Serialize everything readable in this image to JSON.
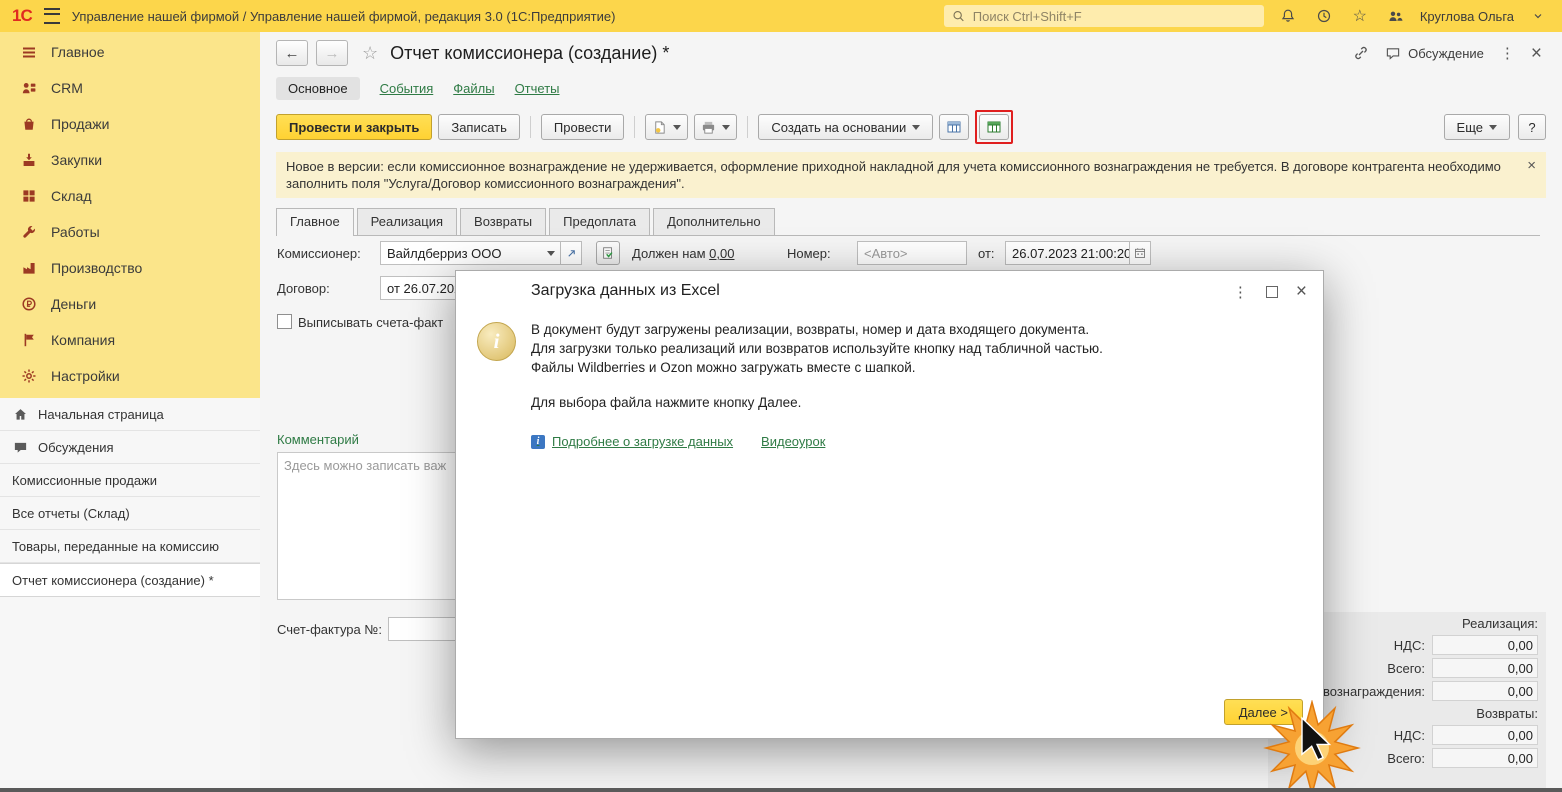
{
  "topbar": {
    "logo": "1С",
    "title": "Управление нашей фирмой / Управление нашей фирмой, редакция 3.0  (1С:Предприятие)",
    "search_placeholder": "Поиск Ctrl+Shift+F",
    "user_name": "Круглова Ольга"
  },
  "sidebar": {
    "sections": [
      {
        "icon": "main-menu-icon",
        "label": "Главное"
      },
      {
        "icon": "crm-icon",
        "label": "CRM"
      },
      {
        "icon": "sales-icon",
        "label": "Продажи"
      },
      {
        "icon": "purchases-icon",
        "label": "Закупки"
      },
      {
        "icon": "warehouse-icon",
        "label": "Склад"
      },
      {
        "icon": "works-icon",
        "label": "Работы"
      },
      {
        "icon": "production-icon",
        "label": "Производство"
      },
      {
        "icon": "money-icon",
        "label": "Деньги"
      },
      {
        "icon": "company-icon",
        "label": "Компания"
      },
      {
        "icon": "settings-icon",
        "label": "Настройки"
      }
    ],
    "pages": [
      {
        "label": "Начальная страница"
      },
      {
        "label": "Обсуждения"
      },
      {
        "label": "Комиссионные продажи"
      },
      {
        "label": "Все отчеты (Склад)"
      },
      {
        "label": "Товары, переданные на комиссию"
      },
      {
        "label": "Отчет комиссионера (создание) *"
      }
    ]
  },
  "doc": {
    "title": "Отчет комиссионера (создание) *",
    "discussion_label": "Обсуждение",
    "section_tabs": [
      "Основное",
      "События",
      "Файлы",
      "Отчеты"
    ],
    "toolbar": {
      "post_and_close": "Провести и закрыть",
      "save": "Записать",
      "post": "Провести",
      "create_based_on": "Создать на основании",
      "more": "Еще",
      "help": "?"
    },
    "notice": "Новое в версии: если комиссионное вознаграждение не удерживается, оформление приходной накладной для учета комиссионного вознаграждения не требуется. В договоре контрагента необходимо заполнить поля \"Услуга/Договор комиссионного вознаграждения\".",
    "doc_tabs": [
      "Главное",
      "Реализация",
      "Возвраты",
      "Предоплата",
      "Дополнительно"
    ],
    "form": {
      "commissioner_label": "Комиссионер:",
      "commissioner_value": "Вайлдберриз ООО",
      "owes_label": "Должен нам",
      "owes_value": "0,00",
      "number_label": "Номер:",
      "number_placeholder": "<Авто>",
      "date_label": "от:",
      "date_value": "26.07.2023 21:00:20",
      "contract_label": "Договор:",
      "contract_value": "от 26.07.202",
      "invoice_checkbox_label": "Выписывать счета-факт",
      "comment_label": "Комментарий",
      "comment_placeholder": "Здесь можно записать важ",
      "invoice_number_label": "Счет-фактура №:"
    },
    "totals": {
      "realization_caption": "Реализация:",
      "realization_rows": [
        {
          "label": "НДС:",
          "value": "0,00"
        },
        {
          "label": "Всего:",
          "value": "0,00"
        }
      ],
      "reward_label": "вознаграждения:",
      "reward_value": "0,00",
      "returns_caption": "Возвраты:",
      "returns_rows": [
        {
          "label": "НДС:",
          "value": "0,00"
        },
        {
          "label": "Всего:",
          "value": "0,00"
        }
      ]
    }
  },
  "modal": {
    "title": "Загрузка данных из Excel",
    "info_lines": [
      "В документ будут загружены реализации, возвраты, номер и дата входящего документа.",
      "Для загрузки только реализаций или возвратов используйте кнопку над табличной частью.",
      "Файлы Wildberries и Ozon можно загружать вместе с шапкой."
    ],
    "action_line": "Для выбора файла нажмите кнопку Далее.",
    "links": [
      {
        "label": "Подробнее о загрузке данных"
      },
      {
        "label": "Видеоурок"
      }
    ],
    "next_button": "Далее >"
  }
}
